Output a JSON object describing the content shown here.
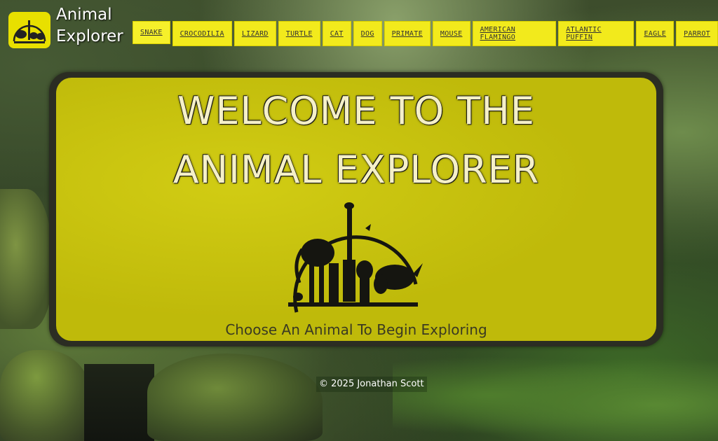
{
  "site": {
    "title_line1": "Animal",
    "title_line2": "Explorer",
    "logo_icon": "animal-group-logo-icon",
    "accent_color": "#f2ea1c"
  },
  "nav": {
    "items": [
      {
        "label": "SNAKE"
      },
      {
        "label": "CROCODILIA"
      },
      {
        "label": "LIZARD"
      },
      {
        "label": "TURTLE"
      },
      {
        "label": "CAT"
      },
      {
        "label": "DOG"
      },
      {
        "label": "PRIMATE"
      },
      {
        "label": "MOUSE"
      },
      {
        "label": "AMERICAN FLAMINGO"
      },
      {
        "label": "ATLANTIC PUFFIN"
      },
      {
        "label": "EAGLE"
      },
      {
        "label": "PARROT"
      }
    ]
  },
  "hero": {
    "heading_line1": "WELCOME TO THE",
    "heading_line2": "ANIMAL EXPLORER",
    "tagline": "Choose An Animal To Begin Exploring"
  },
  "footer": {
    "copyright": "© 2025 Jonathan Scott"
  }
}
